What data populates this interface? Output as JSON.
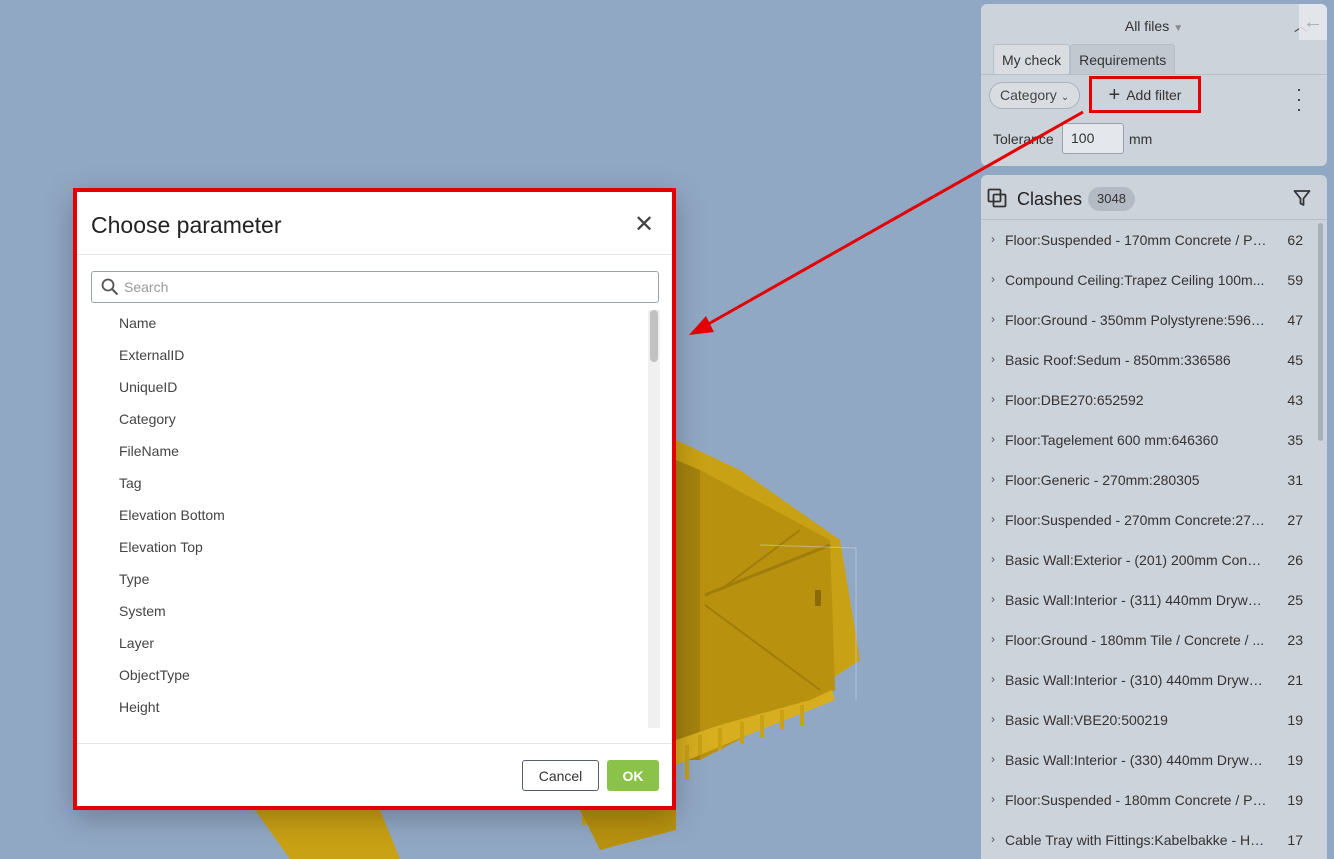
{
  "top_panel": {
    "files_label": "All files",
    "tabs": [
      {
        "label": "My check",
        "active": true
      },
      {
        "label": "Requirements",
        "active": false
      }
    ],
    "category_chip": "Category",
    "add_filter_label": "Add filter",
    "tolerance_label": "Tolerance",
    "tolerance_value": "100",
    "tolerance_unit": "mm"
  },
  "clashes": {
    "title": "Clashes",
    "count": "3048",
    "items": [
      {
        "name": "Floor:Suspended - 170mm Concrete / Po...",
        "count": "62"
      },
      {
        "name": "Compound Ceiling:Trapez Ceiling 100m...",
        "count": "59"
      },
      {
        "name": "Floor:Ground - 350mm Polystyrene:5966...",
        "count": "47"
      },
      {
        "name": "Basic Roof:Sedum - 850mm:336586",
        "count": "45"
      },
      {
        "name": "Floor:DBE270:652592",
        "count": "43"
      },
      {
        "name": "Floor:Tagelement 600 mm:646360",
        "count": "35"
      },
      {
        "name": "Floor:Generic - 270mm:280305",
        "count": "31"
      },
      {
        "name": "Floor:Suspended - 270mm Concrete:275...",
        "count": "27"
      },
      {
        "name": "Basic Wall:Exterior - (201) 200mm Concr...",
        "count": "26"
      },
      {
        "name": "Basic Wall:Interior - (311) 440mm Drywa...",
        "count": "25"
      },
      {
        "name": "Floor:Ground - 180mm Tile / Concrete / ...",
        "count": "23"
      },
      {
        "name": "Basic Wall:Interior - (310) 440mm Drywa...",
        "count": "21"
      },
      {
        "name": "Basic Wall:VBE20:500219",
        "count": "19"
      },
      {
        "name": "Basic Wall:Interior - (330) 440mm Drywa...",
        "count": "19"
      },
      {
        "name": "Floor:Suspended - 180mm Concrete / Po...",
        "count": "19"
      },
      {
        "name": "Cable Tray with Fittings:Kabelbakke - Hjø...",
        "count": "17"
      }
    ]
  },
  "dialog": {
    "title": "Choose parameter",
    "search_placeholder": "Search",
    "params": [
      "Name",
      "ExternalID",
      "UniqueID",
      "Category",
      "FileName",
      "Tag",
      "Elevation Bottom",
      "Elevation Top",
      "Type",
      "System",
      "Layer",
      "ObjectType",
      "Height"
    ],
    "cancel_label": "Cancel",
    "ok_label": "OK"
  },
  "colors": {
    "background": "#91a8c5",
    "highlight": "#e40000",
    "ok_button": "#8bc34a",
    "model": "#c9a114"
  }
}
